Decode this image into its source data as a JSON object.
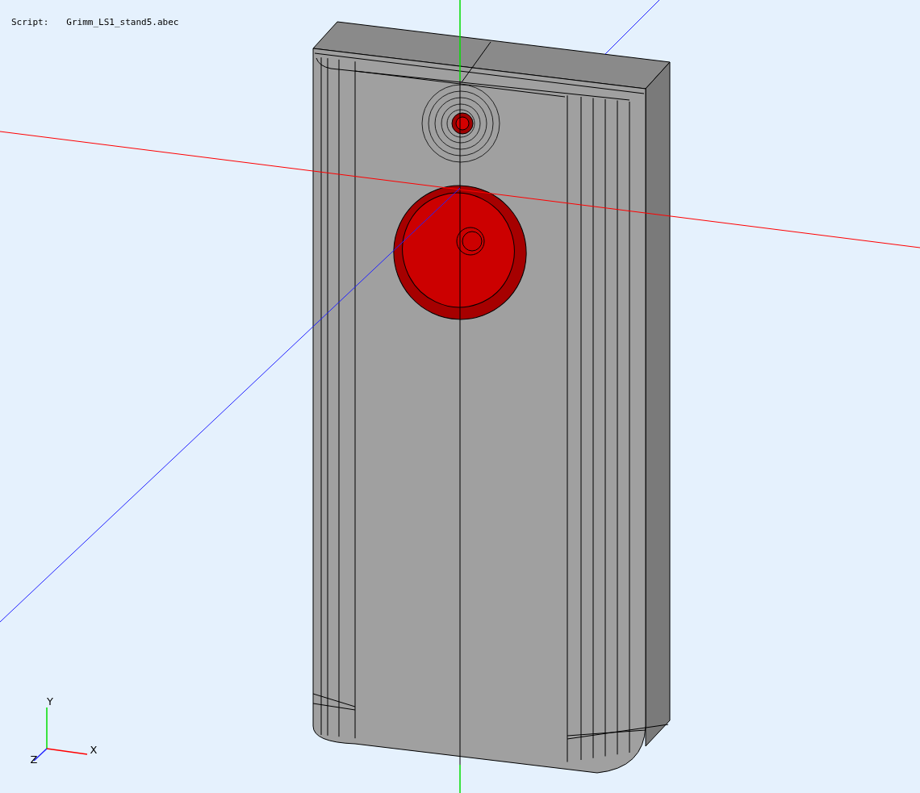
{
  "header": {
    "label": "Script:",
    "value": "Grimm_LS1_stand5.abec"
  },
  "axis_triad": {
    "labels": [
      {
        "kind": "y",
        "text": "Y"
      },
      {
        "kind": "x",
        "text": "X"
      },
      {
        "kind": "z",
        "text": "Z"
      }
    ]
  }
}
